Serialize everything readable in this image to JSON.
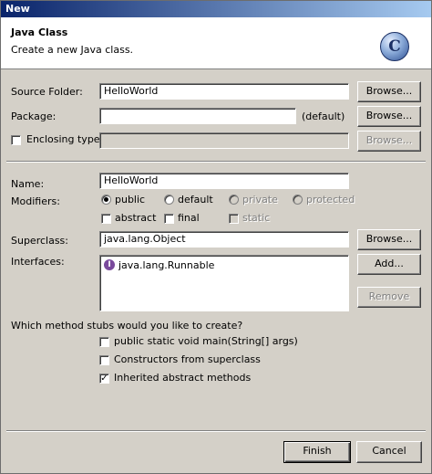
{
  "window": {
    "title": "New"
  },
  "banner": {
    "title": "Java Class",
    "description": "Create a new Java class.",
    "icon_letter": "C"
  },
  "source_folder": {
    "label": "Source Folder:",
    "value": "HelloWorld",
    "browse": "Browse..."
  },
  "package": {
    "label": "Package:",
    "value": "",
    "hint": "(default)",
    "browse": "Browse..."
  },
  "enclosing": {
    "label": "Enclosing type:",
    "checked": false,
    "value": "",
    "browse": "Browse..."
  },
  "name": {
    "label": "Name:",
    "value": "HelloWorld"
  },
  "modifiers": {
    "label": "Modifiers:",
    "access": [
      {
        "label": "public",
        "selected": true,
        "enabled": true
      },
      {
        "label": "default",
        "selected": false,
        "enabled": true
      },
      {
        "label": "private",
        "selected": false,
        "enabled": false
      },
      {
        "label": "protected",
        "selected": false,
        "enabled": false
      }
    ],
    "flags": [
      {
        "label": "abstract",
        "checked": false,
        "enabled": true
      },
      {
        "label": "final",
        "checked": false,
        "enabled": true
      },
      {
        "label": "static",
        "checked": false,
        "enabled": false
      }
    ]
  },
  "superclass": {
    "label": "Superclass:",
    "value": "java.lang.Object",
    "browse": "Browse..."
  },
  "interfaces": {
    "label": "Interfaces:",
    "items": [
      "java.lang.Runnable"
    ],
    "icon_letter": "I",
    "add": "Add...",
    "remove": "Remove"
  },
  "stubs": {
    "question": "Which method stubs would you like to create?",
    "options": [
      {
        "label": "public static void main(String[] args)",
        "checked": false
      },
      {
        "label": "Constructors from superclass",
        "checked": false
      },
      {
        "label": "Inherited abstract methods",
        "checked": true
      }
    ]
  },
  "footer": {
    "finish": "Finish",
    "cancel": "Cancel"
  }
}
